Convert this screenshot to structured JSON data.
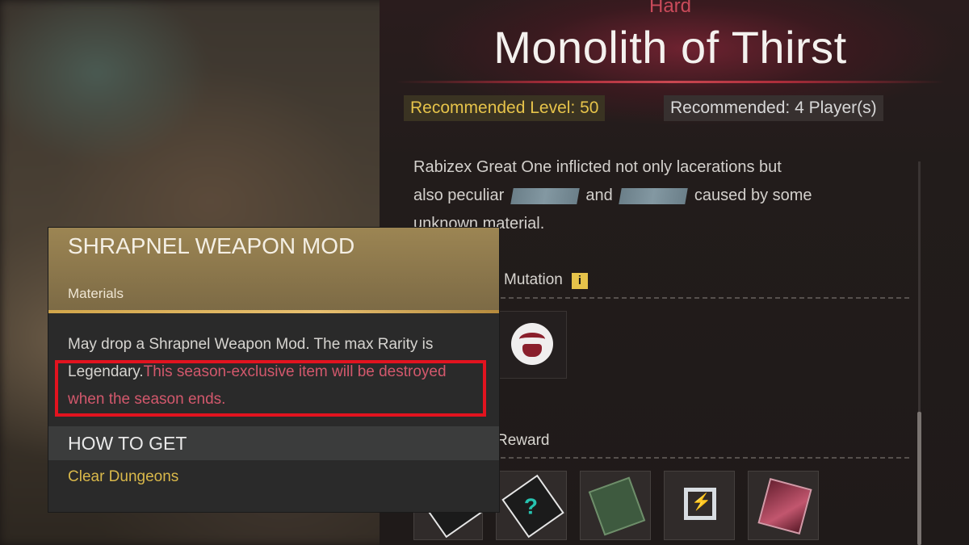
{
  "dungeon": {
    "difficulty": "Hard",
    "title": "Monolith of Thirst",
    "recommended_level": "Recommended Level: 50",
    "recommended_players": "Recommended: 4 Player(s)",
    "description": {
      "line1": "Rabizex Great One inflicted not only lacerations but",
      "line2_a": "also peculiar",
      "line2_b": "and",
      "line2_c": "caused by some",
      "line3": "unknown material."
    },
    "mutation_label": "Mutation",
    "mutation_info_icon": "info-icon",
    "reward_label": "Reward",
    "rewards": [
      "weapon-icon",
      "mystery-weapon-icon",
      "circuit-chip-icon",
      "energy-frame-icon",
      "card-item-icon"
    ]
  },
  "tooltip": {
    "title": "SHRAPNEL WEAPON MOD",
    "category": "Materials",
    "body_normal": "May drop a Shrapnel Weapon Mod. The max Rarity is Legendary.",
    "body_warning": "This season-exclusive item will be destroyed when the season ends.",
    "how_to_get": "HOW TO GET",
    "source": "Clear Dungeons"
  },
  "colors": {
    "accent_gold": "#e6c34a",
    "warning_pink": "#d2586c",
    "highlight_red": "#e2131f",
    "header_gold": "#9c8553"
  }
}
